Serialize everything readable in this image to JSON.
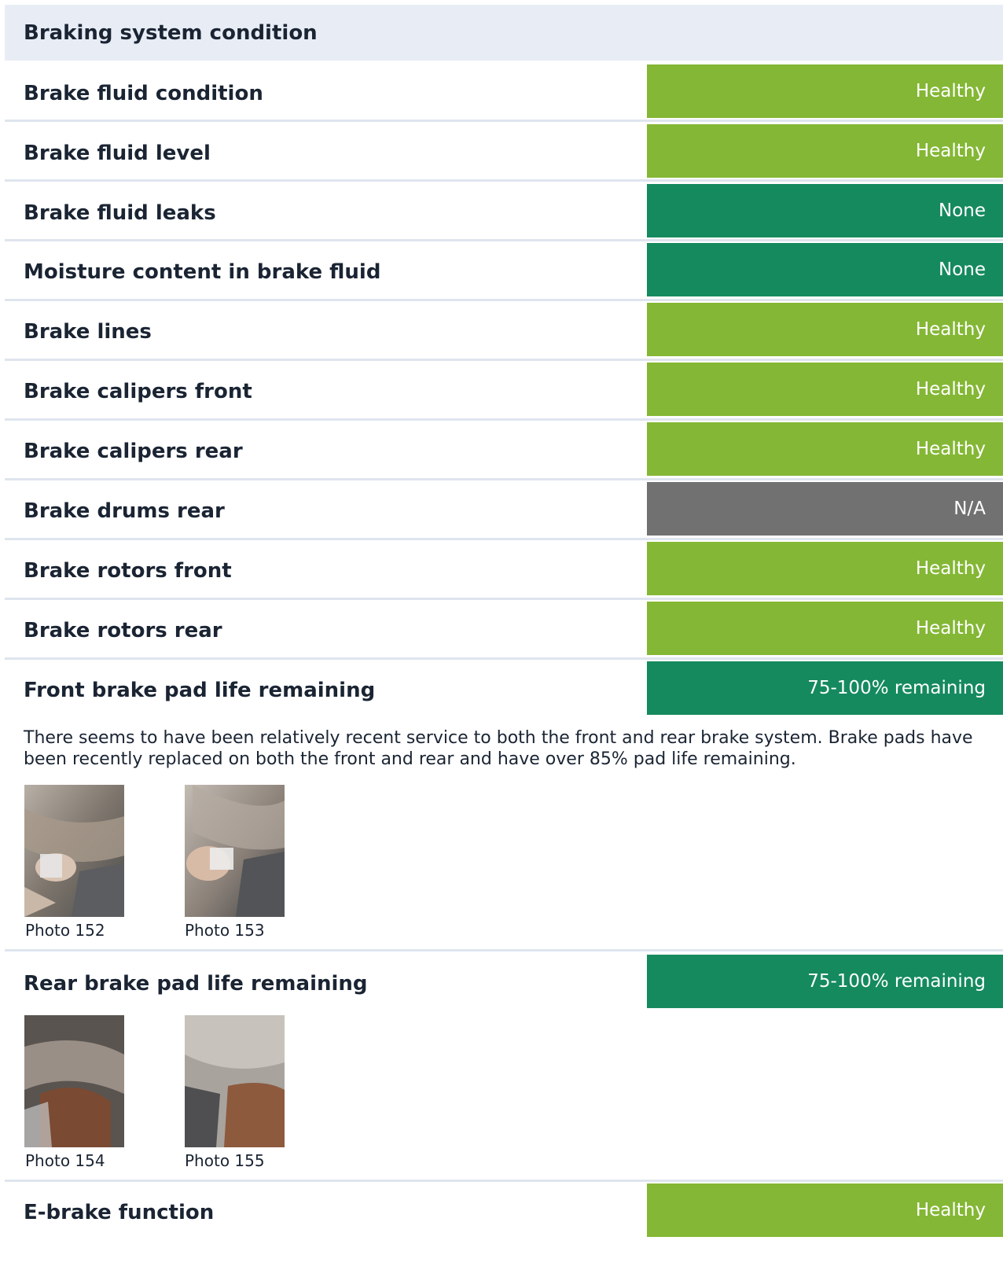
{
  "section": {
    "title": "Braking system condition"
  },
  "colors": {
    "healthy": "#84b735",
    "good": "#158a5e",
    "na": "#717171",
    "header_bg": "#e8edf5",
    "divider": "#dfe5ee"
  },
  "items": [
    {
      "label": "Brake fluid condition",
      "status": "Healthy"
    },
    {
      "label": "Brake fluid level",
      "status": "Healthy"
    },
    {
      "label": "Brake fluid leaks",
      "status": "None"
    },
    {
      "label": "Moisture content in brake fluid",
      "status": "None"
    },
    {
      "label": "Brake lines",
      "status": "Healthy"
    },
    {
      "label": "Brake calipers front",
      "status": "Healthy"
    },
    {
      "label": "Brake calipers rear",
      "status": "Healthy"
    },
    {
      "label": "Brake drums rear",
      "status": "N/A"
    },
    {
      "label": "Brake rotors front",
      "status": "Healthy"
    },
    {
      "label": "Brake rotors rear",
      "status": "Healthy"
    },
    {
      "label": "Front brake pad life remaining",
      "status": "75-100% remaining"
    },
    {
      "label": "Rear brake pad life remaining",
      "status": "75-100% remaining"
    },
    {
      "label": "E-brake function",
      "status": "Healthy"
    }
  ],
  "front_pads": {
    "note": "There seems to have been relatively recent service to both the front and rear brake system. Brake pads have been recently replaced on both the front and rear and have over 85% pad life remaining.",
    "photos": [
      {
        "caption": "Photo 152"
      },
      {
        "caption": "Photo 153"
      }
    ]
  },
  "rear_pads": {
    "photos": [
      {
        "caption": "Photo 154"
      },
      {
        "caption": "Photo 155"
      }
    ]
  }
}
